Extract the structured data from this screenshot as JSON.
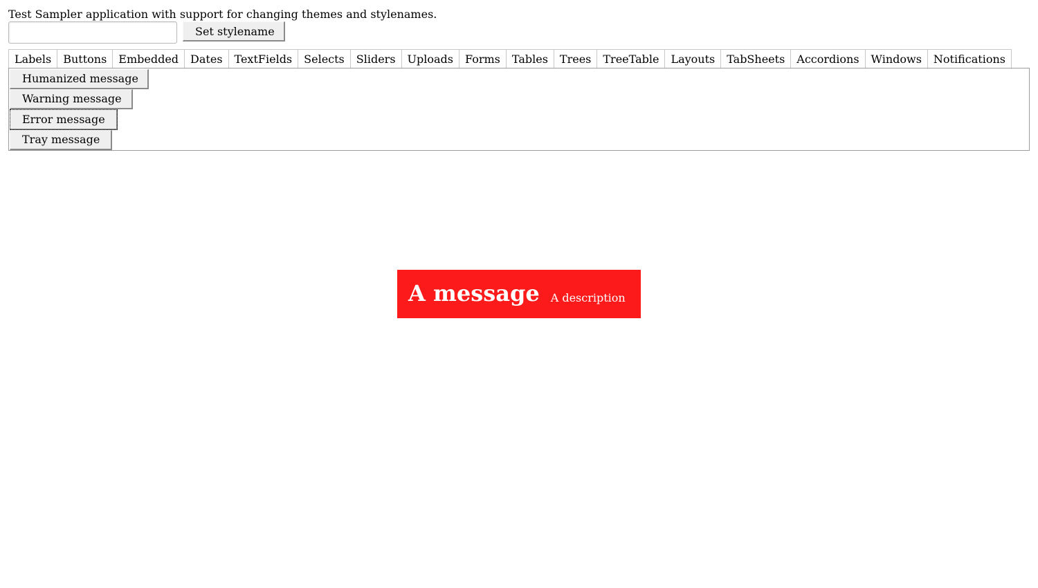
{
  "app": {
    "description": "Test Sampler application with support for changing themes and stylenames."
  },
  "toolbar": {
    "stylename_input_value": "",
    "set_stylename_label": "Set stylename"
  },
  "tabs": [
    {
      "label": "Labels"
    },
    {
      "label": "Buttons"
    },
    {
      "label": "Embedded"
    },
    {
      "label": "Dates"
    },
    {
      "label": "TextFields"
    },
    {
      "label": "Selects"
    },
    {
      "label": "Sliders"
    },
    {
      "label": "Uploads"
    },
    {
      "label": "Forms"
    },
    {
      "label": "Tables"
    },
    {
      "label": "Trees"
    },
    {
      "label": "TreeTable"
    },
    {
      "label": "Layouts"
    },
    {
      "label": "TabSheets"
    },
    {
      "label": "Accordions"
    },
    {
      "label": "Windows"
    },
    {
      "label": "Notifications"
    }
  ],
  "selected_tab": "Notifications",
  "notifications_panel": {
    "buttons": {
      "humanized": "Humanized message",
      "warning": "Warning message",
      "error": "Error message",
      "tray": "Tray message"
    },
    "focused_button": "Error message"
  },
  "notification": {
    "caption": "A message",
    "description": "A description",
    "background_color": "#fc1a1b",
    "text_color": "#ffffff"
  }
}
